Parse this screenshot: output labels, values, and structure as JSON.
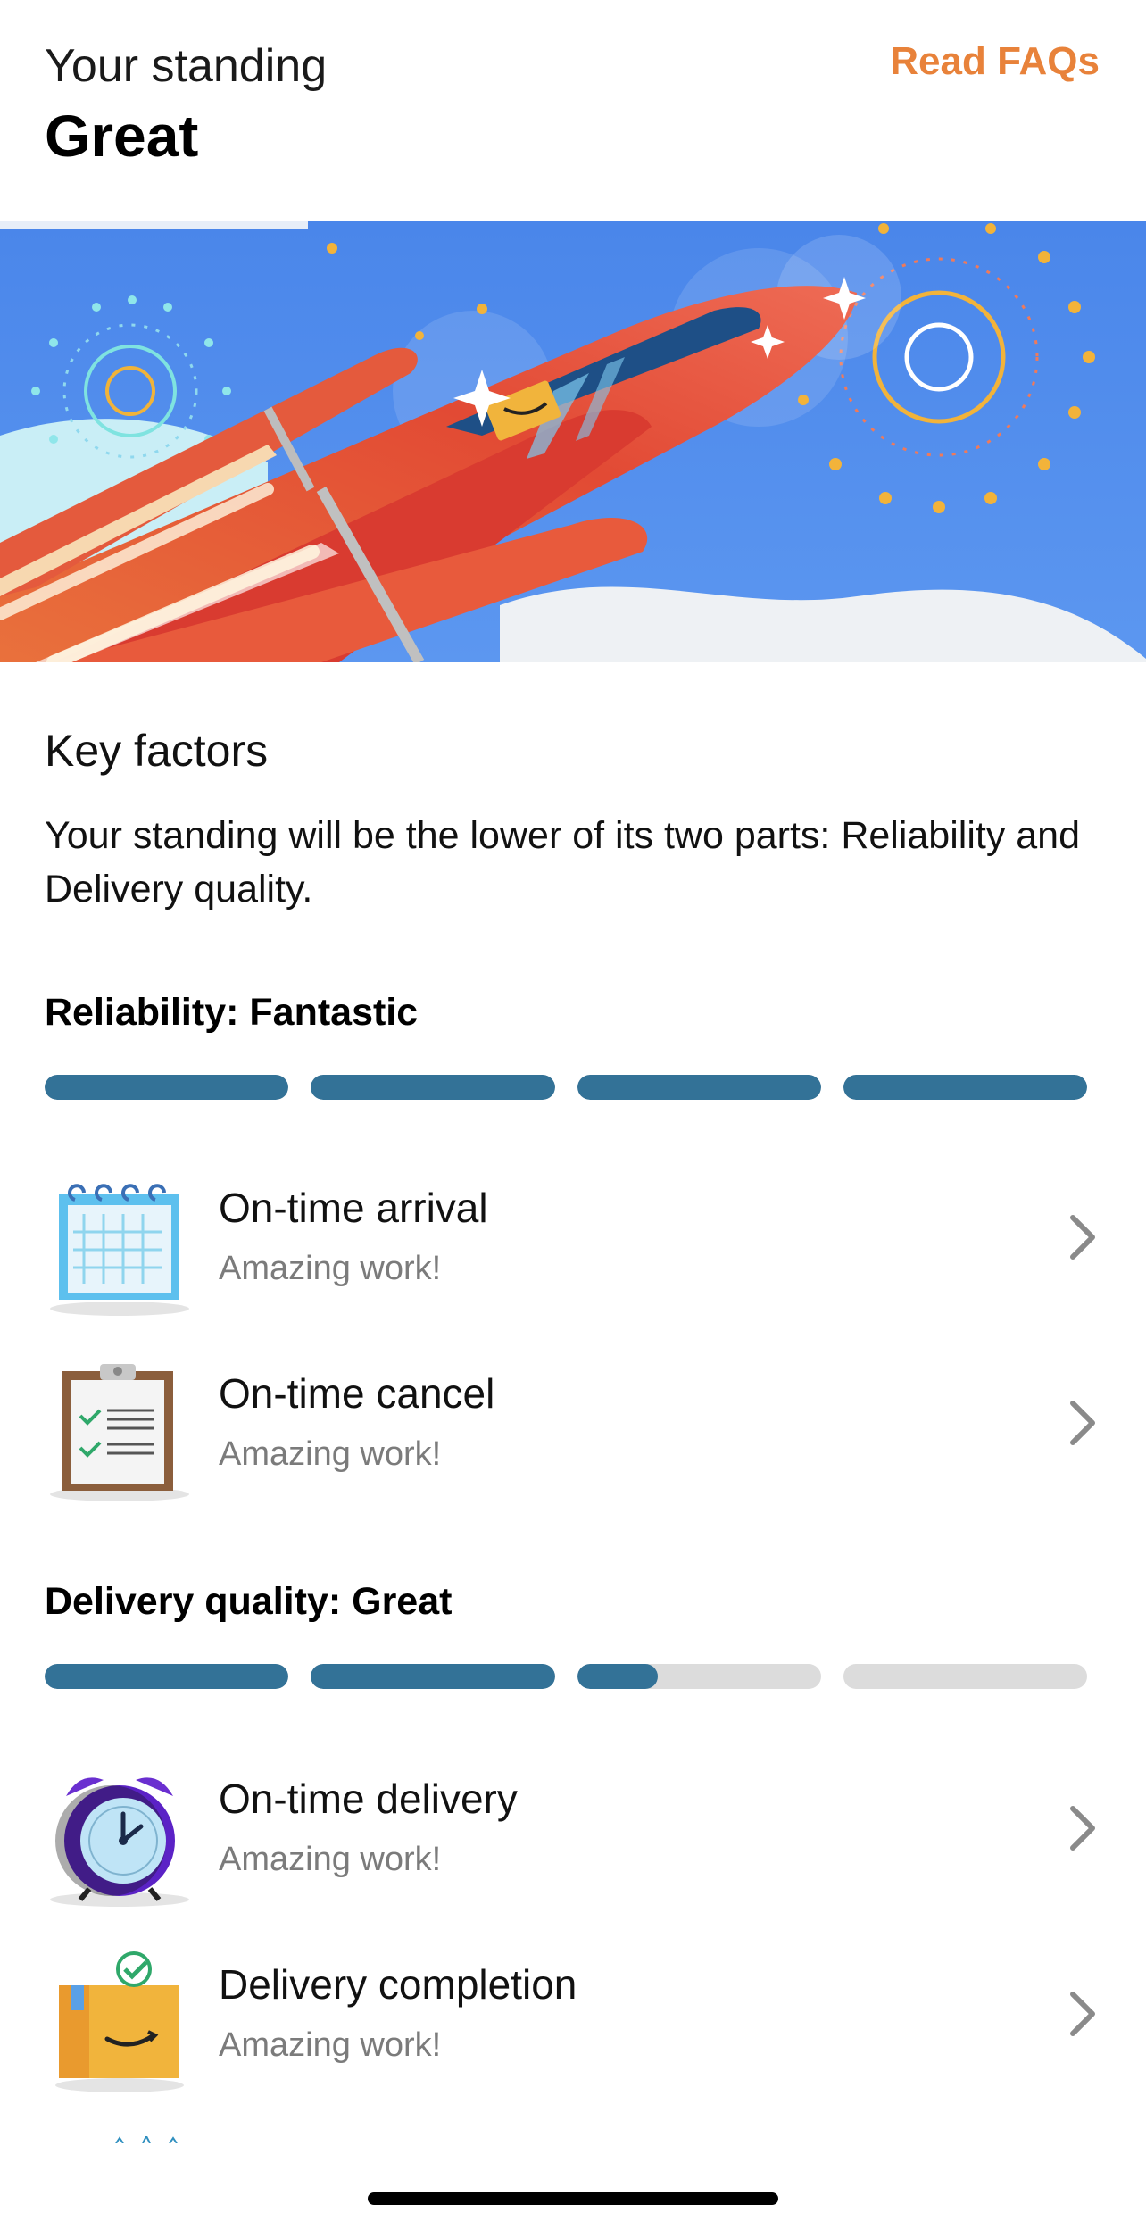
{
  "header": {
    "standing_label": "Your standing",
    "standing_value": "Great",
    "faq_link": "Read FAQs",
    "accent_color": "#e8823a"
  },
  "key_factors": {
    "title": "Key factors",
    "description": "Your standing will be the lower of its two parts: Reliability and Delivery quality."
  },
  "reliability": {
    "title": "Reliability: Fantastic",
    "bar_levels": [
      1,
      1,
      1,
      1
    ],
    "bar_color": "#337297",
    "items": [
      {
        "name": "On-time arrival",
        "status": "Amazing work!",
        "icon": "calendar-icon"
      },
      {
        "name": "On-time cancel",
        "status": "Amazing work!",
        "icon": "clipboard-icon"
      }
    ]
  },
  "delivery_quality": {
    "title": "Delivery quality: Great",
    "bar_levels": [
      1,
      1,
      0.33,
      0
    ],
    "bar_color": "#337297",
    "items": [
      {
        "name": "On-time delivery",
        "status": "Amazing work!",
        "icon": "alarm-clock-icon"
      },
      {
        "name": "Delivery completion",
        "status": "Amazing work!",
        "icon": "package-icon"
      }
    ]
  }
}
